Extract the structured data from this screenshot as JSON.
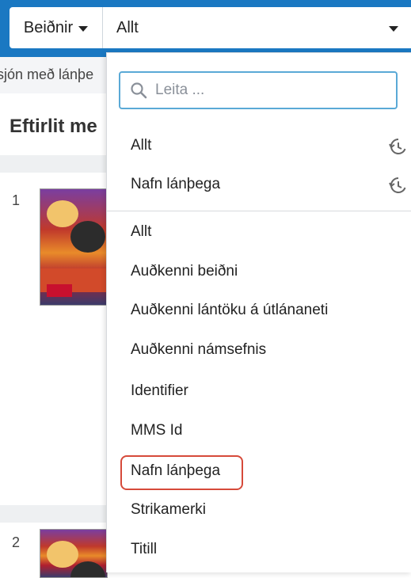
{
  "header": {
    "scope_label": "Beiðnir",
    "field_selected": "Allt"
  },
  "background": {
    "subtitle": "sjón með lánþe",
    "title": "Eftirlit me",
    "rows": [
      "1",
      "2"
    ]
  },
  "dropdown": {
    "filter_placeholder": "Leita ...",
    "recent": [
      {
        "label": "Allt",
        "icon": "history-icon"
      },
      {
        "label": "Nafn lánþega",
        "icon": "history-icon"
      }
    ],
    "options": [
      "Allt",
      "Auðkenni beiðni",
      "Auðkenni lántöku á útlánaneti",
      "Auðkenni námsefnis",
      "Identifier",
      "MMS Id",
      "Nafn lánþega",
      "Strikamerki",
      "Titill"
    ],
    "highlighted_option": "Nafn lánþega"
  },
  "colors": {
    "topbar": "#1a78c2",
    "input_focus": "#5aa9d6",
    "highlight": "#d64a3a"
  }
}
